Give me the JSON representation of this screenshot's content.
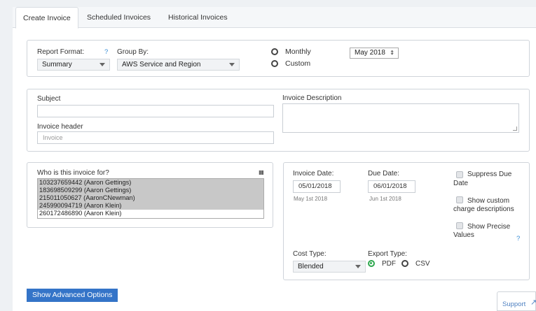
{
  "tabs": [
    {
      "label": "Create Invoice",
      "active": true
    },
    {
      "label": "Scheduled Invoices",
      "active": false
    },
    {
      "label": "Historical Invoices",
      "active": false
    }
  ],
  "report": {
    "format_label": "Report Format:",
    "format_help": "?",
    "format_value": "Summary",
    "group_label": "Group By:",
    "group_value": "AWS Service and Region",
    "period_options": [
      {
        "label": "Monthly",
        "selected": false
      },
      {
        "label": "Custom",
        "selected": false
      }
    ],
    "month_value": "May 2018"
  },
  "details": {
    "subject_label": "Subject",
    "subject_value": "",
    "header_label": "Invoice header",
    "header_placeholder": "Invoice",
    "description_label": "Invoice Description"
  },
  "recipients": {
    "label": "Who is this invoice for?",
    "accounts": [
      {
        "text": "103237659442 (Aaron Gettings)",
        "selected": true
      },
      {
        "text": "183698509299 (Aaron Gettings)",
        "selected": true
      },
      {
        "text": "215011050627 (AaronCNewman)",
        "selected": true
      },
      {
        "text": "245990094719 (Aaron Klein)",
        "selected": true
      },
      {
        "text": "260172486890 (Aaron Klein)",
        "selected": false
      }
    ]
  },
  "dates": {
    "invoice_date_label": "Invoice Date:",
    "invoice_date_value": "05/01/2018",
    "invoice_date_hint": "May 1st 2018",
    "due_date_label": "Due Date:",
    "due_date_value": "06/01/2018",
    "due_date_hint": "Jun 1st 2018"
  },
  "options": {
    "suppress_due_line1": "Suppress Due",
    "suppress_due_line2": "Date",
    "custom_charge_line1": "Show custom",
    "custom_charge_line2": "charge descriptions",
    "precise_line1": "Show Precise",
    "precise_line2": "Values",
    "precise_help": "?"
  },
  "cost": {
    "cost_type_label": "Cost Type:",
    "cost_type_value": "Blended",
    "export_type_label": "Export Type:",
    "export_options": [
      {
        "label": "PDF",
        "selected": true
      },
      {
        "label": "CSV",
        "selected": false
      }
    ]
  },
  "actions": {
    "advanced_label": "Show Advanced Options",
    "support_label": "Support"
  },
  "colors": {
    "accent": "#3474c8",
    "radio_on": "#2fa84f"
  }
}
